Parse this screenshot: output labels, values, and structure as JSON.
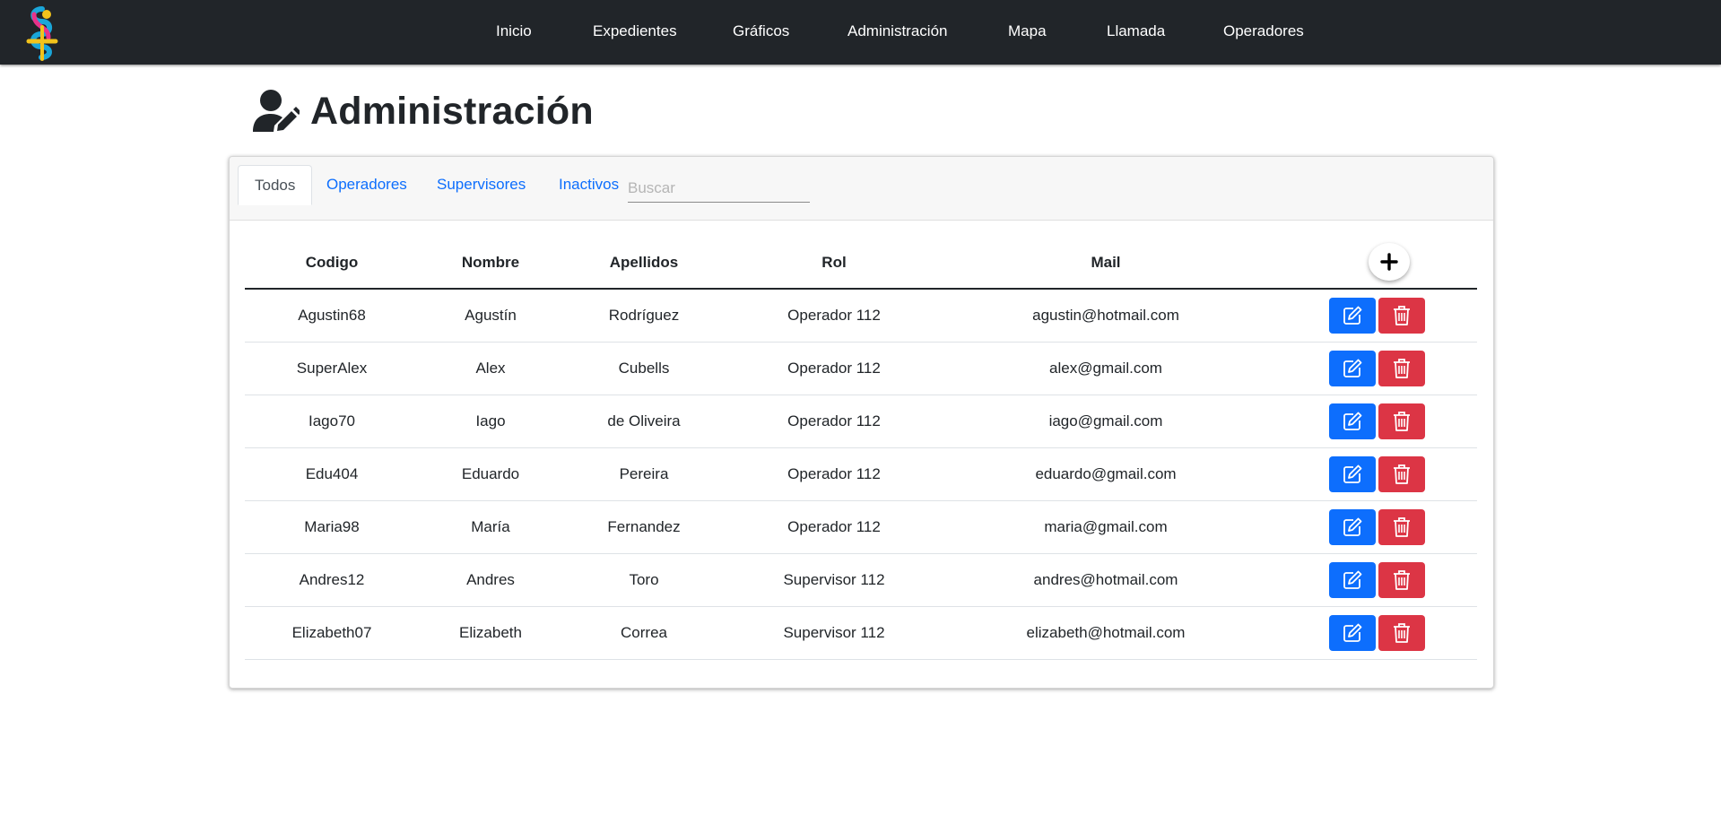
{
  "navbar": {
    "links": [
      "Inicio",
      "Expedientes",
      "Gráficos",
      "Administración",
      "Mapa",
      "Llamada",
      "Operadores"
    ]
  },
  "page": {
    "title": "Administración"
  },
  "tabs": [
    "Todos",
    "Operadores",
    "Supervisores",
    "Inactivos"
  ],
  "active_tab": "Todos",
  "search": {
    "placeholder": "Buscar",
    "value": ""
  },
  "table": {
    "headers": [
      "Codigo",
      "Nombre",
      "Apellidos",
      "Rol",
      "Mail"
    ],
    "rows": [
      [
        "Agustin68",
        "Agustín",
        "Rodríguez",
        "Operador 112",
        "agustin@hotmail.com"
      ],
      [
        "SuperAlex",
        "Alex",
        "Cubells",
        "Operador 112",
        "alex@gmail.com"
      ],
      [
        "Iago70",
        "Iago",
        "de Oliveira",
        "Operador 112",
        "iago@gmail.com"
      ],
      [
        "Edu404",
        "Eduardo",
        "Pereira",
        "Operador 112",
        "eduardo@gmail.com"
      ],
      [
        "Maria98",
        "María",
        "Fernandez",
        "Operador 112",
        "maria@gmail.com"
      ],
      [
        "Andres12",
        "Andres",
        "Toro",
        "Supervisor 112",
        "andres@hotmail.com"
      ],
      [
        "Elizabeth07",
        "Elizabeth",
        "Correa",
        "Supervisor 112",
        "elizabeth@hotmail.com"
      ]
    ]
  },
  "icons": {
    "logo": "app-logo",
    "title": "user-edit-icon",
    "add": "plus-icon",
    "edit": "edit-icon",
    "delete": "trash-icon"
  },
  "colors": {
    "navbar": "#212529",
    "link": "#0d6efd",
    "edit_button": "#0d6efd",
    "delete_button": "#dc3545"
  }
}
